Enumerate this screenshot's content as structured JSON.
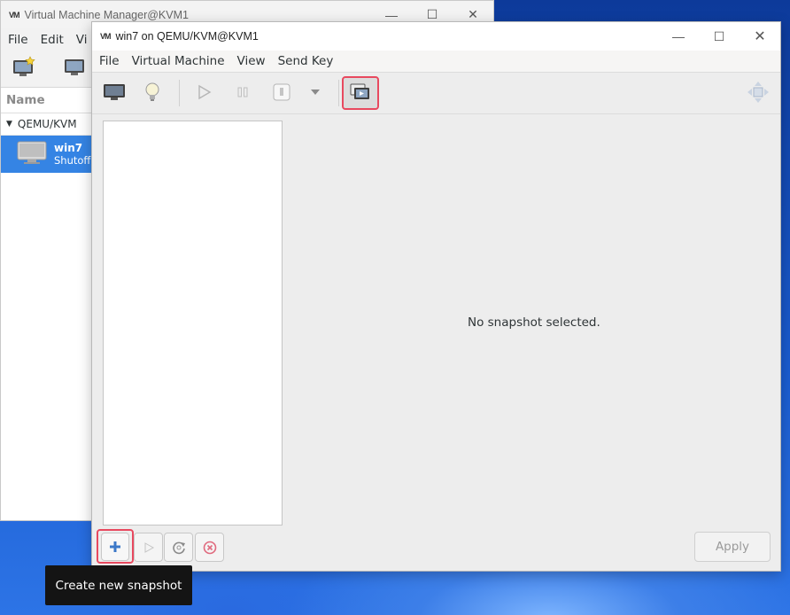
{
  "back_window": {
    "logo": "VM",
    "title": "Virtual Machine Manager@KVM1",
    "menu": [
      "File",
      "Edit",
      "Vi"
    ],
    "list_header": "Name",
    "group": "QEMU/KVM",
    "vm": {
      "name": "win7",
      "status": "Shutoff"
    }
  },
  "front_window": {
    "logo": "VM",
    "title": "win7 on QEMU/KVM@KVM1",
    "window_controls": {
      "minimize": "—",
      "maximize": "☐",
      "close": "✕"
    },
    "menu": [
      "File",
      "Virtual Machine",
      "View",
      "Send Key"
    ],
    "toolbar": {
      "icons": [
        "console-monitor-icon",
        "lightbulb-details-icon",
        "run-icon",
        "pause-icon",
        "shutdown-icon",
        "shutdown-menu-arrow-icon",
        "snapshots-icon",
        "fullscreen-icon"
      ],
      "highlighted": "snapshots-icon"
    },
    "empty_message": "No snapshot selected.",
    "bottom_buttons": [
      "add-snapshot-icon",
      "run-snapshot-icon",
      "refresh-snapshot-icon",
      "delete-snapshot-icon"
    ],
    "apply_label": "Apply"
  },
  "tooltip": "Create new snapshot",
  "colors": {
    "highlight": "#e8495f",
    "selection": "#3584e4",
    "add_icon": "#3c78c8",
    "delete_icon": "#e06a7e"
  }
}
